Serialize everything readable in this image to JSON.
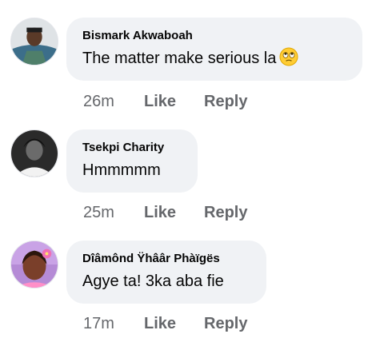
{
  "comments": [
    {
      "author": "Bismark Akwaboah",
      "text": "The matter make serious la",
      "emoji_icon": "face-with-rolling-eyes-icon",
      "time": "26m",
      "like_label": "Like",
      "reply_label": "Reply"
    },
    {
      "author": "Tsekpi Charity",
      "text": "Hmmmmm",
      "time": "25m",
      "like_label": "Like",
      "reply_label": "Reply"
    },
    {
      "author": "Dîâmônd Ÿhââr Phàïgës",
      "text": "Agye ta! 3ka aba fie",
      "time": "17m",
      "like_label": "Like",
      "reply_label": "Reply"
    }
  ],
  "colors": {
    "bubble_bg": "#f0f2f5",
    "meta_text": "#65676b",
    "primary_text": "#050505"
  }
}
